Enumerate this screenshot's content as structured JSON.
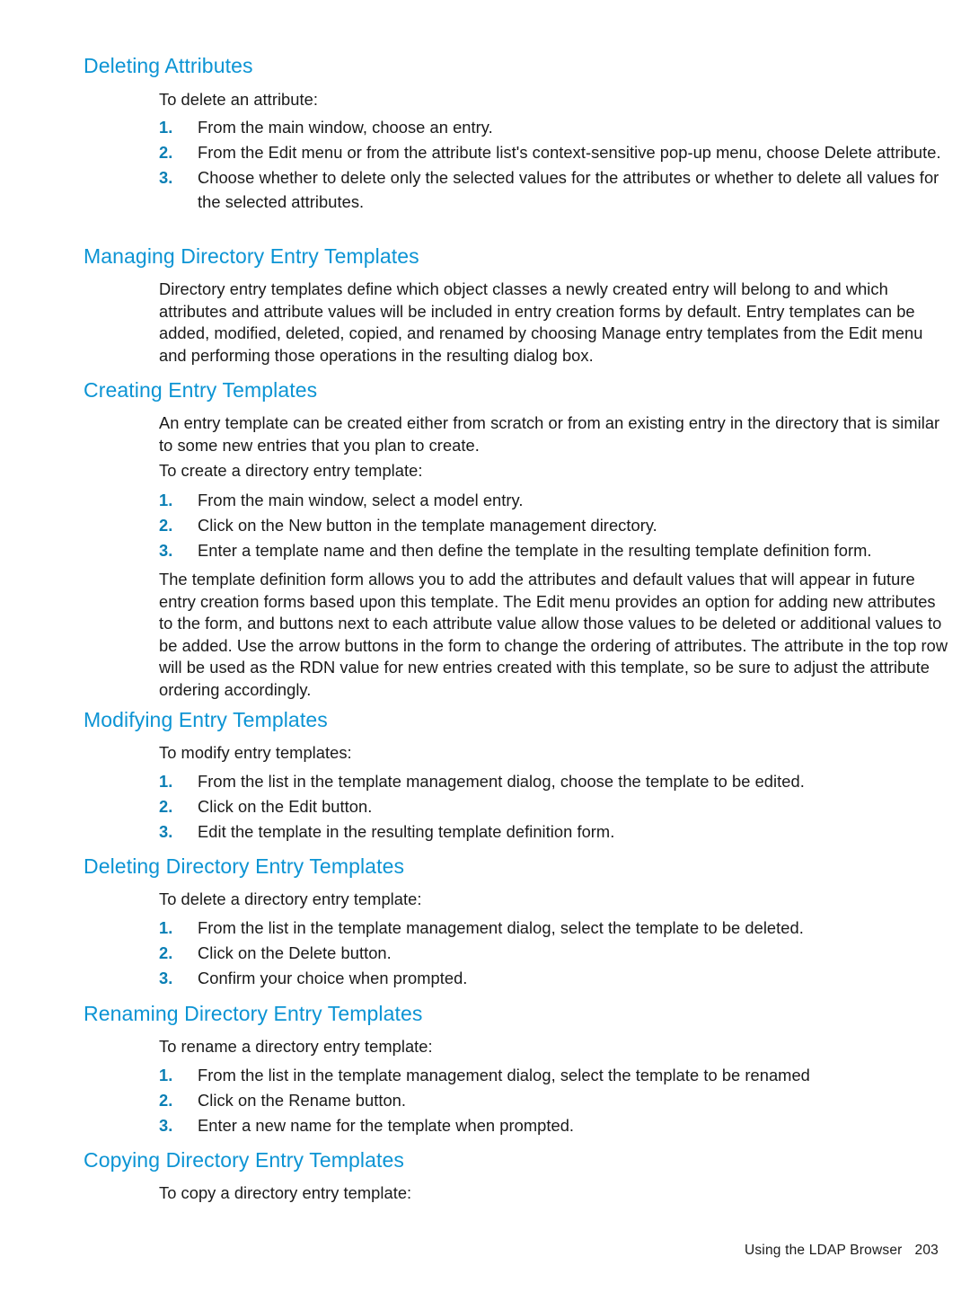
{
  "colors": {
    "heading": "#0c94d4",
    "list_number": "#0a7fb5",
    "body_text": "#1a1a1a",
    "background": "#ffffff"
  },
  "sections": [
    {
      "heading": "Deleting Attributes",
      "lead": "To delete an attribute:",
      "steps": [
        "From the main window, choose an entry.",
        "From the Edit menu or from the attribute list's context-sensitive pop-up menu, choose Delete attribute.",
        "Choose whether to delete only the selected values for the attributes or whether to delete all values for the selected attributes."
      ]
    },
    {
      "heading": "Managing Directory Entry Templates",
      "paragraph": "Directory entry templates define which object classes a newly created entry will belong to and which attributes and attribute values will be included in entry creation forms by default. Entry templates can be added, modified, deleted, copied, and renamed by choosing Manage entry templates from the Edit menu and performing those operations in the resulting dialog box."
    },
    {
      "heading": "Creating Entry Templates",
      "paragraph": "An entry template can be created either from scratch or from an existing entry in the directory that is similar to some new entries that you plan to create.",
      "lead": "To create a directory entry template:",
      "steps": [
        "From the main window, select a model entry.",
        "Click on the New button in the template management directory.",
        "Enter a template name and then define the template in the resulting template definition form."
      ],
      "trailing_paragraph": "The template definition form allows you to add the attributes and default values that will appear in future entry creation forms based upon this template. The Edit menu provides an option for adding new attributes to the form, and buttons next to each attribute value allow those values to be deleted or additional values to be added. Use the arrow buttons in the form to change the ordering of attributes. The attribute in the top row will be used as the RDN value for new entries created with this template, so be sure to adjust the attribute ordering accordingly."
    },
    {
      "heading": "Modifying Entry Templates",
      "lead": "To modify entry templates:",
      "steps": [
        "From the list in the template management dialog, choose the template to be edited.",
        "Click on the Edit button.",
        "Edit the template in the resulting template definition form."
      ]
    },
    {
      "heading": "Deleting Directory Entry Templates",
      "lead": "To delete a directory entry template:",
      "steps": [
        "From the list in the template management dialog, select the template to be deleted.",
        "Click on the Delete button.",
        "Confirm your choice when prompted."
      ]
    },
    {
      "heading": "Renaming Directory Entry Templates",
      "lead": "To rename a directory entry template:",
      "steps": [
        "From the list in the template management dialog, select the template to be renamed",
        "Click on the Rename button.",
        "Enter a new name for the template when prompted."
      ]
    },
    {
      "heading": "Copying Directory Entry Templates",
      "lead": "To copy a directory entry template:"
    }
  ],
  "step_markers": {
    "one": "1.",
    "two": "2.",
    "three": "3."
  },
  "footer": {
    "label": "Using the LDAP Browser",
    "page_number": "203"
  }
}
